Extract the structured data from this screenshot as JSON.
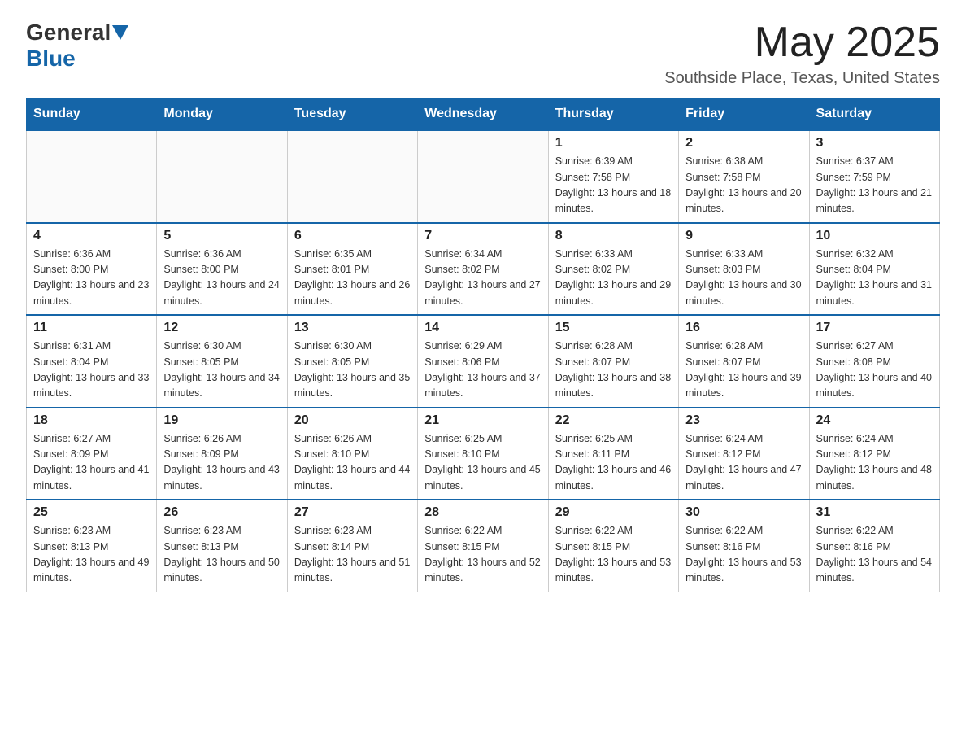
{
  "header": {
    "logo_general": "General",
    "logo_blue": "Blue",
    "month_year": "May 2025",
    "location": "Southside Place, Texas, United States"
  },
  "days_of_week": [
    "Sunday",
    "Monday",
    "Tuesday",
    "Wednesday",
    "Thursday",
    "Friday",
    "Saturday"
  ],
  "weeks": [
    [
      {
        "day": "",
        "info": ""
      },
      {
        "day": "",
        "info": ""
      },
      {
        "day": "",
        "info": ""
      },
      {
        "day": "",
        "info": ""
      },
      {
        "day": "1",
        "info": "Sunrise: 6:39 AM\nSunset: 7:58 PM\nDaylight: 13 hours and 18 minutes."
      },
      {
        "day": "2",
        "info": "Sunrise: 6:38 AM\nSunset: 7:58 PM\nDaylight: 13 hours and 20 minutes."
      },
      {
        "day": "3",
        "info": "Sunrise: 6:37 AM\nSunset: 7:59 PM\nDaylight: 13 hours and 21 minutes."
      }
    ],
    [
      {
        "day": "4",
        "info": "Sunrise: 6:36 AM\nSunset: 8:00 PM\nDaylight: 13 hours and 23 minutes."
      },
      {
        "day": "5",
        "info": "Sunrise: 6:36 AM\nSunset: 8:00 PM\nDaylight: 13 hours and 24 minutes."
      },
      {
        "day": "6",
        "info": "Sunrise: 6:35 AM\nSunset: 8:01 PM\nDaylight: 13 hours and 26 minutes."
      },
      {
        "day": "7",
        "info": "Sunrise: 6:34 AM\nSunset: 8:02 PM\nDaylight: 13 hours and 27 minutes."
      },
      {
        "day": "8",
        "info": "Sunrise: 6:33 AM\nSunset: 8:02 PM\nDaylight: 13 hours and 29 minutes."
      },
      {
        "day": "9",
        "info": "Sunrise: 6:33 AM\nSunset: 8:03 PM\nDaylight: 13 hours and 30 minutes."
      },
      {
        "day": "10",
        "info": "Sunrise: 6:32 AM\nSunset: 8:04 PM\nDaylight: 13 hours and 31 minutes."
      }
    ],
    [
      {
        "day": "11",
        "info": "Sunrise: 6:31 AM\nSunset: 8:04 PM\nDaylight: 13 hours and 33 minutes."
      },
      {
        "day": "12",
        "info": "Sunrise: 6:30 AM\nSunset: 8:05 PM\nDaylight: 13 hours and 34 minutes."
      },
      {
        "day": "13",
        "info": "Sunrise: 6:30 AM\nSunset: 8:05 PM\nDaylight: 13 hours and 35 minutes."
      },
      {
        "day": "14",
        "info": "Sunrise: 6:29 AM\nSunset: 8:06 PM\nDaylight: 13 hours and 37 minutes."
      },
      {
        "day": "15",
        "info": "Sunrise: 6:28 AM\nSunset: 8:07 PM\nDaylight: 13 hours and 38 minutes."
      },
      {
        "day": "16",
        "info": "Sunrise: 6:28 AM\nSunset: 8:07 PM\nDaylight: 13 hours and 39 minutes."
      },
      {
        "day": "17",
        "info": "Sunrise: 6:27 AM\nSunset: 8:08 PM\nDaylight: 13 hours and 40 minutes."
      }
    ],
    [
      {
        "day": "18",
        "info": "Sunrise: 6:27 AM\nSunset: 8:09 PM\nDaylight: 13 hours and 41 minutes."
      },
      {
        "day": "19",
        "info": "Sunrise: 6:26 AM\nSunset: 8:09 PM\nDaylight: 13 hours and 43 minutes."
      },
      {
        "day": "20",
        "info": "Sunrise: 6:26 AM\nSunset: 8:10 PM\nDaylight: 13 hours and 44 minutes."
      },
      {
        "day": "21",
        "info": "Sunrise: 6:25 AM\nSunset: 8:10 PM\nDaylight: 13 hours and 45 minutes."
      },
      {
        "day": "22",
        "info": "Sunrise: 6:25 AM\nSunset: 8:11 PM\nDaylight: 13 hours and 46 minutes."
      },
      {
        "day": "23",
        "info": "Sunrise: 6:24 AM\nSunset: 8:12 PM\nDaylight: 13 hours and 47 minutes."
      },
      {
        "day": "24",
        "info": "Sunrise: 6:24 AM\nSunset: 8:12 PM\nDaylight: 13 hours and 48 minutes."
      }
    ],
    [
      {
        "day": "25",
        "info": "Sunrise: 6:23 AM\nSunset: 8:13 PM\nDaylight: 13 hours and 49 minutes."
      },
      {
        "day": "26",
        "info": "Sunrise: 6:23 AM\nSunset: 8:13 PM\nDaylight: 13 hours and 50 minutes."
      },
      {
        "day": "27",
        "info": "Sunrise: 6:23 AM\nSunset: 8:14 PM\nDaylight: 13 hours and 51 minutes."
      },
      {
        "day": "28",
        "info": "Sunrise: 6:22 AM\nSunset: 8:15 PM\nDaylight: 13 hours and 52 minutes."
      },
      {
        "day": "29",
        "info": "Sunrise: 6:22 AM\nSunset: 8:15 PM\nDaylight: 13 hours and 53 minutes."
      },
      {
        "day": "30",
        "info": "Sunrise: 6:22 AM\nSunset: 8:16 PM\nDaylight: 13 hours and 53 minutes."
      },
      {
        "day": "31",
        "info": "Sunrise: 6:22 AM\nSunset: 8:16 PM\nDaylight: 13 hours and 54 minutes."
      }
    ]
  ]
}
